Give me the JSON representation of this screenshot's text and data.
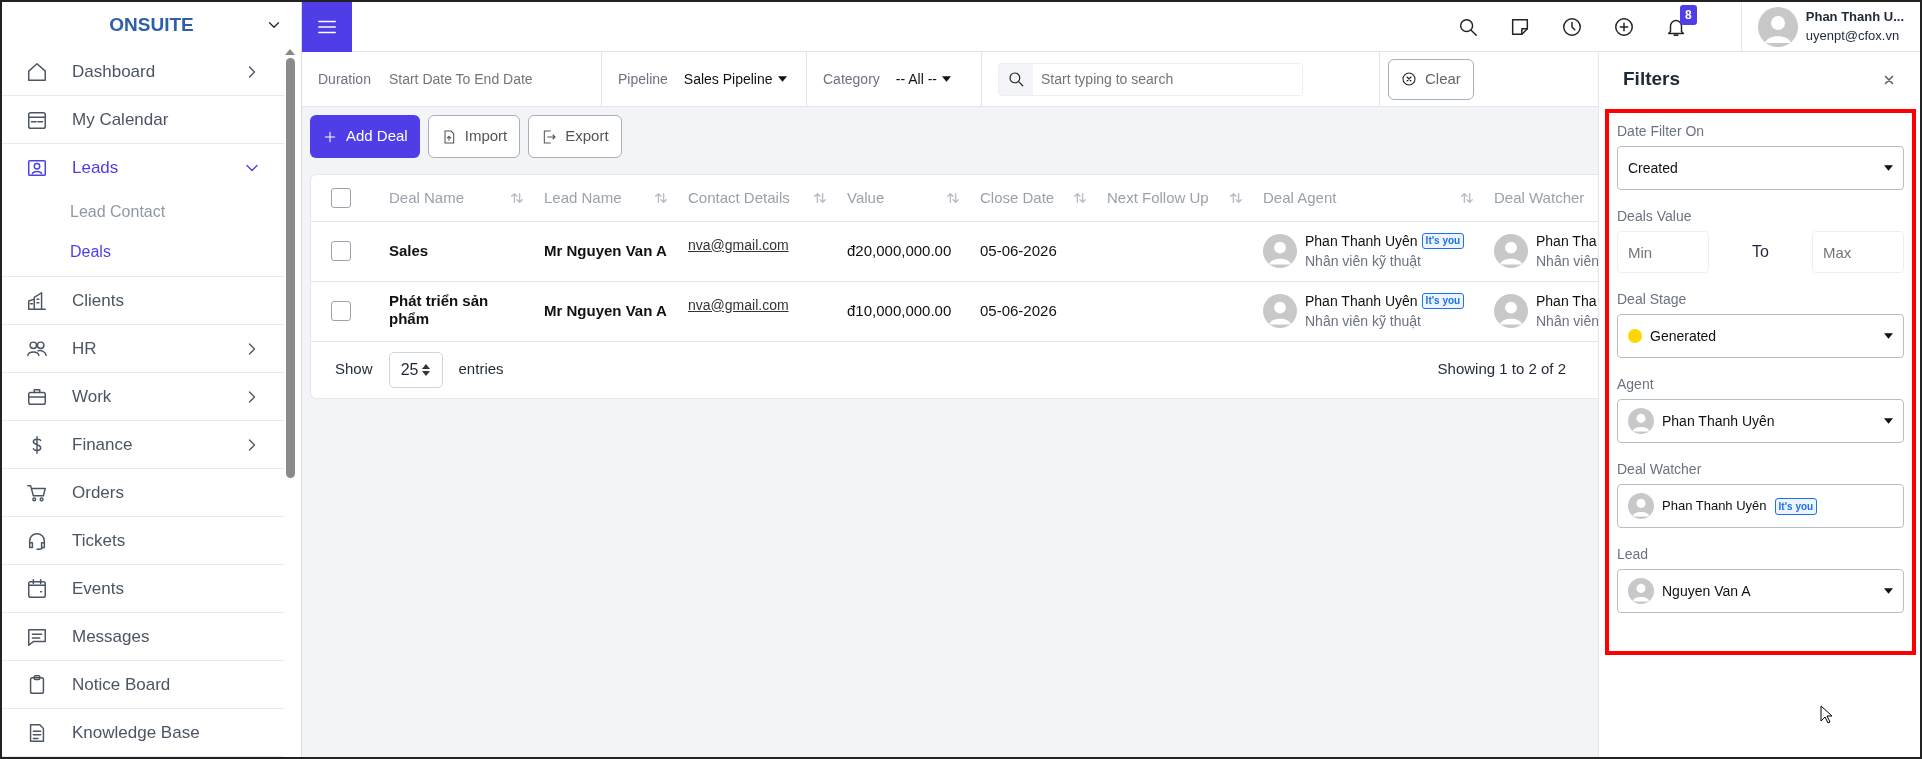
{
  "sidebar": {
    "brand": "ONSUITE",
    "items": [
      {
        "label": "Dashboard",
        "selected": false,
        "expanded": false
      },
      {
        "label": "My Calendar",
        "selected": false
      },
      {
        "label": "Leads",
        "selected": true,
        "expanded": true,
        "children": [
          {
            "label": "Lead Contact",
            "selected": false
          },
          {
            "label": "Deals",
            "selected": true
          }
        ]
      },
      {
        "label": "Clients",
        "selected": false
      },
      {
        "label": "HR",
        "selected": false,
        "expanded": false
      },
      {
        "label": "Work",
        "selected": false,
        "expanded": false
      },
      {
        "label": "Finance",
        "selected": false,
        "expanded": false
      },
      {
        "label": "Orders",
        "selected": false
      },
      {
        "label": "Tickets",
        "selected": false
      },
      {
        "label": "Events",
        "selected": false
      },
      {
        "label": "Messages",
        "selected": false
      },
      {
        "label": "Notice Board",
        "selected": false
      },
      {
        "label": "Knowledge Base",
        "selected": false
      }
    ]
  },
  "topbar": {
    "notification_count": "8",
    "user": {
      "name": "Phan Thanh U...",
      "email": "uyenpt@cfox.vn"
    }
  },
  "filter_bar": {
    "duration": {
      "label": "Duration",
      "placeholder": "Start Date To End Date"
    },
    "pipeline": {
      "label": "Pipeline",
      "value": "Sales Pipeline"
    },
    "category": {
      "label": "Category",
      "value": "-- All --"
    },
    "search": {
      "placeholder": "Start typing to search"
    },
    "clear_button": "Clear"
  },
  "actions": [
    {
      "kind": "add",
      "label": "Add Deal"
    },
    {
      "kind": "import",
      "label": "Import"
    },
    {
      "kind": "export",
      "label": "Export"
    }
  ],
  "table": {
    "select_all_checked": false,
    "columns": [
      {
        "label": "Deal Name",
        "sortable": true
      },
      {
        "label": "Lead Name",
        "sortable": true
      },
      {
        "label": "Contact Details",
        "sortable": true
      },
      {
        "label": "Value",
        "sortable": true
      },
      {
        "label": "Close Date",
        "sortable": true
      },
      {
        "label": "Next Follow Up",
        "sortable": true
      },
      {
        "label": "Deal Agent",
        "sortable": true
      },
      {
        "label": "Deal Watcher",
        "sortable": false
      }
    ],
    "rows": [
      {
        "checked": false,
        "deal_name": "Sales",
        "lead_name": "Mr Nguyen Van A",
        "contact": "nva@gmail.com",
        "value": "đ20,000,000.00",
        "close_date": "05-06-2026",
        "agent": {
          "name": "Phan Thanh Uyên",
          "badge": "It's you",
          "role": "Nhân viên kỹ thuật"
        },
        "watcher": {
          "name": "Phan Tha",
          "role": "Nhân viên"
        }
      },
      {
        "checked": false,
        "deal_name": "Phát triển sản phẩm",
        "lead_name": "Mr Nguyen Van A",
        "contact": "nva@gmail.com",
        "value": "đ10,000,000.00",
        "close_date": "05-06-2026",
        "agent": {
          "name": "Phan Thanh Uyên",
          "badge": "It's you",
          "role": "Nhân viên kỹ thuật"
        },
        "watcher": {
          "name": "Phan Tha",
          "role": "Nhân viên"
        }
      }
    ],
    "footer": {
      "show_label": "Show",
      "page_size": "25",
      "entries_label": "entries",
      "summary": "Showing 1 to 2 of 2"
    }
  },
  "filters": {
    "title": "Filters",
    "highlighted": true,
    "fields": [
      {
        "kind": "select",
        "label": "Date Filter On",
        "value": "Created"
      },
      {
        "kind": "range",
        "label": "Deals Value",
        "min_placeholder": "Min",
        "separator": "To",
        "max_placeholder": "Max"
      },
      {
        "kind": "select",
        "label": "Deal Stage",
        "value": "Generated",
        "color": "#ffd600"
      },
      {
        "kind": "select",
        "label": "Agent",
        "value": "Phan Thanh Uyên",
        "avatar": true
      },
      {
        "kind": "multiselect",
        "label": "Deal Watcher",
        "value": "Phan Thanh Uyên",
        "badge": "It's you",
        "avatar": true
      },
      {
        "kind": "select",
        "label": "Lead",
        "value": "Nguyen Van A",
        "avatar": true
      }
    ]
  }
}
